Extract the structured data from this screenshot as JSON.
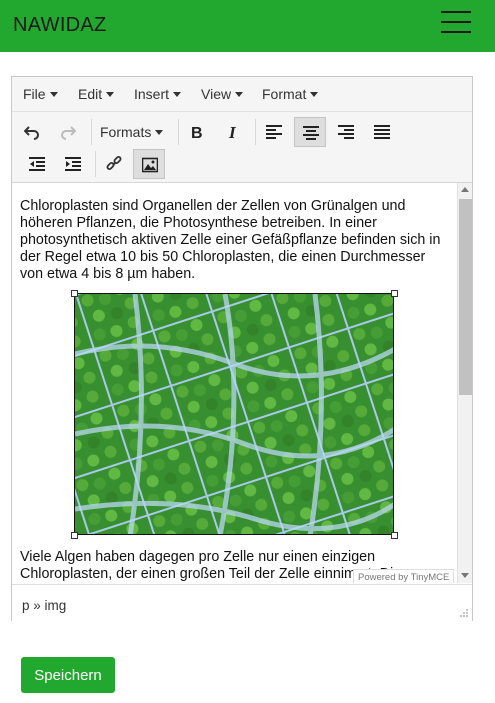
{
  "app": {
    "brand": "NAWIDAZ"
  },
  "menubar": {
    "items": [
      "File",
      "Edit",
      "Insert",
      "View",
      "Format"
    ]
  },
  "toolbar": {
    "formats_label": "Formats",
    "buttons": [
      "undo-icon",
      "redo-icon",
      "bold-icon",
      "italic-icon",
      "align-left-icon",
      "align-center-icon",
      "align-right-icon",
      "justify-icon",
      "outdent-icon",
      "indent-icon",
      "link-icon",
      "image-icon"
    ],
    "active": [
      "align-center-icon",
      "image-icon"
    ]
  },
  "content": {
    "paragraph1": "Chloroplasten sind Organellen der Zellen von Grünalgen und höheren Pflanzen, die Photosynthese betreiben. In einer photosynthetisch aktiven Zelle einer Gefäßpflanze befinden sich in der Regel etwa 10 bis 50 Chloroplasten, die einen Durchmesser von etwa 4 bis 8 µm haben.",
    "paragraph2": "Viele Algen haben dagegen pro Zelle nur einen einzigen Chloroplasten, der einen großen Teil der Zelle einnimmt. Die",
    "image_subject": "chloroplast-cells-micrograph"
  },
  "editor": {
    "powered_by": "Powered by TinyMCE",
    "path": "p » img"
  },
  "actions": {
    "save_label": "Speichern"
  },
  "colors": {
    "brand_green": "#22a82e",
    "toolbar_bg": "#f5f5f5"
  }
}
